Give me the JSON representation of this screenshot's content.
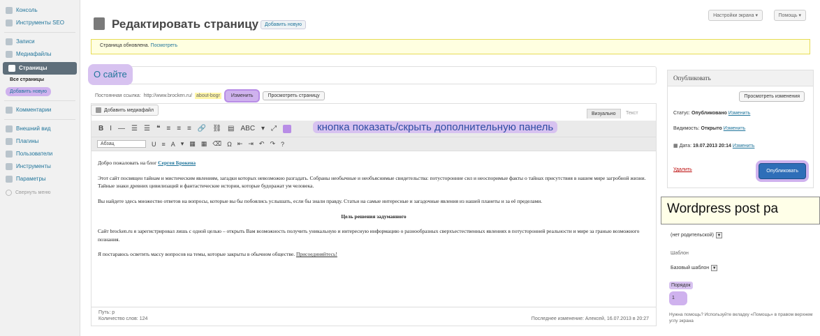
{
  "sidebar": {
    "items": [
      {
        "label": "Консоль",
        "icon": "dashboard-icon"
      },
      {
        "label": "Инструменты SEO",
        "icon": "seo-tools-icon"
      },
      {
        "label": "Записи",
        "icon": "posts-icon"
      },
      {
        "label": "Медиафайлы",
        "icon": "media-icon"
      },
      {
        "label": "Страницы",
        "icon": "pages-icon"
      },
      {
        "label": "Комментарии",
        "icon": "comments-icon"
      },
      {
        "label": "Внешний вид",
        "icon": "appearance-icon"
      },
      {
        "label": "Плагины",
        "icon": "plugins-icon"
      },
      {
        "label": "Пользователи",
        "icon": "users-icon"
      },
      {
        "label": "Инструменты",
        "icon": "tools-icon"
      },
      {
        "label": "Параметры",
        "icon": "settings-icon"
      }
    ],
    "sub_all_pages": "Все страницы",
    "sub_add_new": "Добавить новую",
    "collapse": "Свернуть меню"
  },
  "top": {
    "screen_options": "Настройки экрана ▾",
    "help": "Помощь ▾"
  },
  "header": {
    "title": "Редактировать страницу",
    "add_new": "Добавить новую"
  },
  "notice": {
    "text": "Страница обновлена.",
    "link": "Посмотреть"
  },
  "post": {
    "title": "О сайте",
    "permalink_label": "Постоянная ссылка:",
    "permalink_url": "http://www.brocken.ru/",
    "permalink_slug": "about-bogr",
    "edit_button": "Изменить",
    "view_button": "Просмотреть страницу"
  },
  "editor": {
    "media_button": "Добавить медиафайл",
    "tab_visual": "Визуально",
    "tab_text": "Текст",
    "kitchen_sink_label": "кнопка показать/скрыть дополнительную панель",
    "format_select": "Абзац",
    "toolbar1": [
      "B",
      "I",
      "—",
      "☰",
      "☰",
      "❝",
      "≡",
      "≡",
      "≡",
      "🔗",
      "⛓",
      "▤",
      "ABC",
      "▾",
      "⤢"
    ],
    "toolbar2": [
      "U",
      "≡",
      "A",
      "▾",
      "▦",
      "▦",
      "⌫",
      "Ω",
      "⇤",
      "⇥",
      "↶",
      "↷",
      "?"
    ],
    "content": {
      "greeting_prefix": "Добро пожаловать на блог",
      "greeting_link": "Сергея Брокена",
      "p1": "Этот сайт посвящен тайнам и мистическим явлениям, загадки которых невозможно разгадать. Собраны необычные и необъяснимые свидетельства: потусторонние сил и неоспоримые факты о тайнах присутствия в нашем мире загробной жизни. Тайные знаки древних цивилизаций и фантастические истории, которые будоражат ум человека.",
      "p2": "Вы найдете здесь множество ответов на вопросы, которые вы бы побоялись услышать, если бы знали правду. Статьи на самые интересные и загадочные явления из нашей планеты и за её пределами.",
      "heading": "Цель решения задуманного",
      "p3": "Сайт brocken.ru я зарегистрировал лишь с одной целью – открыть Вам возможность получить уникальную и интересную информацию о разнообразных сверхъестественных явлениях в потусторонней реальности и мире за гранью возможного познания.",
      "p4_prefix": "Я постараюсь осветить массу вопросов на темы, которые закрыты в обычном обществе.",
      "p4_link": "Присоединяйтесь!"
    },
    "path": "Путь: p",
    "word_count": "Количество слов: 124",
    "last_edited": "Последнее изменение: Алексей, 16.07.2013 в 20:27"
  },
  "publish": {
    "heading": "Опубликовать",
    "preview": "Просмотреть изменения",
    "status_label": "Статус:",
    "status_value": "Опубликовано",
    "status_edit": "Изменить",
    "visibility_label": "Видимость:",
    "visibility_value": "Открыто",
    "visibility_edit": "Изменить",
    "date_label": "Дата:",
    "date_value": "19.07.2013 20:14",
    "date_edit": "Изменить",
    "delete": "Удалить",
    "update_button": "Опубликовать"
  },
  "attributes": {
    "tooltip": "Wordpress post pa",
    "parent_select": "(нет родительской)",
    "template_label": "Шаблон",
    "template_select": "Базовый шаблон",
    "order_label": "Порядок",
    "order_value": "1",
    "help": "Нужна помощь? Используйте вкладку «Помощь» в правом верхнем углу экрана"
  }
}
